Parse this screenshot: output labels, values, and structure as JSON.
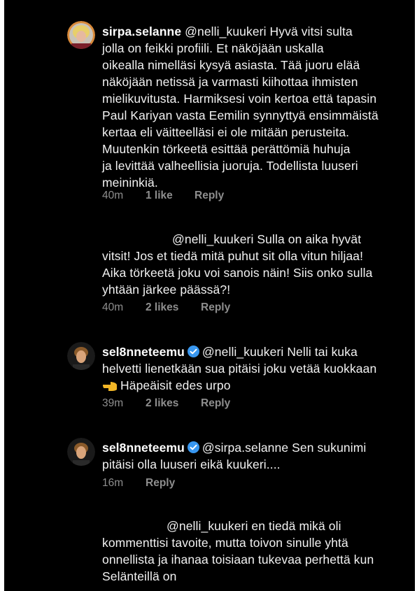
{
  "comments": [
    {
      "username": "sirpa.selanne",
      "verified": false,
      "text": "@nelli_kuukeri Hyvä vitsi sulta jolla on feikki profiili. Et näköjään uskalla oikealla nimelläsi kysyä asiasta. Tää juoru elää näköjään netissä ja varmasti kiihottaa ihmisten mielikuvitusta. Harmiksesi voin kertoa että tapasin Paul Kariyan vasta Eemilin synnyttyä ensimmäistä kertaa eli väitteelläsi ei ole mitään perusteita. Muutenkin törkeetä esittää perättömiä huhuja ja levittää valheellisia juoruja.  Todellista luuseri meininkiä.",
      "lines": [
        "@nelli_kuukeri Hyvä vitsi sulta",
        "jolla on feikki profiili. Et näköjään uskalla",
        "oikealla nimelläsi kysyä asiasta. Tää juoru elää",
        "näköjään netissä ja varmasti kiihottaa ihmisten",
        "mielikuvitusta. Harmiksesi voin kertoa että tapasin",
        "Paul Kariyan vasta Eemilin synnyttyä ensimmäistä",
        "kertaa eli väitteelläsi ei ole mitään perusteita.",
        "Muutenkin törkeetä esittää perättömiä huhuja",
        "ja levittää valheellisia juoruja.  Todellista luuseri",
        "meininkiä."
      ],
      "time": "40m",
      "likes": "1 like",
      "reply": "Reply"
    },
    {
      "username": "",
      "verified": false,
      "lines": [
        "@nelli_kuukeri  Sulla on aika hyvät",
        "vitsit! Jos et tiedä mitä puhut sit olla vitun hiljaa!",
        "Aika törkeetä joku voi sanois näin! Siis onko sulla",
        "yhtään järkee päässä?!"
      ],
      "time": "40m",
      "likes": "2 likes",
      "reply": "Reply"
    },
    {
      "username": "sel8nneteemu",
      "verified": true,
      "lines": [
        "@nelli_kuukeri Nelli tai kuka",
        "helvetti lienetkään sua pitäisi joku vetää kuokkaan",
        "Häpeäisit edes urpo"
      ],
      "emoji": "backhand-index-pointing-left",
      "time": "39m",
      "likes": "2 likes",
      "reply": "Reply"
    },
    {
      "username": "sel8nneteemu",
      "verified": true,
      "lines": [
        "@sirpa.selanne Sen sukunimi",
        "pitäisi olla luuseri eikä kuukeri...."
      ],
      "time": "16m",
      "reply": "Reply"
    },
    {
      "username": "",
      "verified": false,
      "lines": [
        "@nelli_kuukeri en tiedä mikä oli",
        "kommenttisi tavoite, mutta toivon sinulle yhtä",
        "onnellista ja ihanaa toisiaan tukevaa perhettä kun",
        "Selänteillä on"
      ]
    }
  ],
  "colors": {
    "background": "#000000",
    "text": "#f2f2f2",
    "meta": "#8e8e8e",
    "verified": "#3897f0"
  }
}
